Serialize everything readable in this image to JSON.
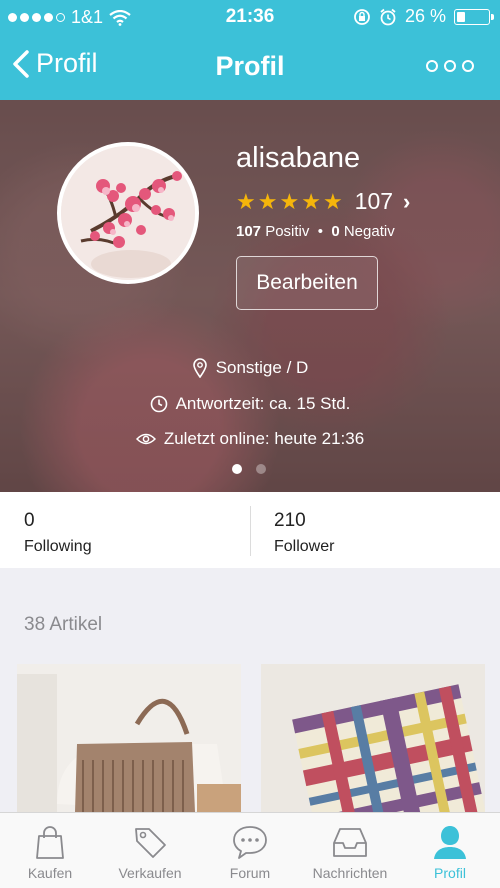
{
  "status": {
    "carrier": "1&1",
    "time": "21:36",
    "battery": "26 %",
    "battery_level": 0.26
  },
  "nav": {
    "back_label": "Profil",
    "title": "Profil"
  },
  "profile": {
    "username": "alisabane",
    "rating_count": "107",
    "stars": 5,
    "positive_count": "107",
    "positive_label": "Positiv",
    "negative_count": "0",
    "negative_label": "Negativ",
    "edit_label": "Bearbeiten",
    "location": "Sonstige / D",
    "response_time": "Antwortzeit: ca. 15 Std.",
    "last_online": "Zuletzt online: heute 21:36",
    "pager": {
      "count": 2,
      "active": 0
    }
  },
  "stats": {
    "following_count": "0",
    "following_label": "Following",
    "follower_count": "210",
    "follower_label": "Follower"
  },
  "articles": {
    "label": "38 Artikel"
  },
  "tabs": [
    {
      "label": "Kaufen",
      "icon": "shopping-bag-icon"
    },
    {
      "label": "Verkaufen",
      "icon": "tag-icon"
    },
    {
      "label": "Forum",
      "icon": "chat-bubble-icon"
    },
    {
      "label": "Nachrichten",
      "icon": "inbox-icon"
    },
    {
      "label": "Profil",
      "icon": "person-icon"
    }
  ],
  "colors": {
    "accent": "#3cc1d8",
    "star": "#f5b50b"
  }
}
